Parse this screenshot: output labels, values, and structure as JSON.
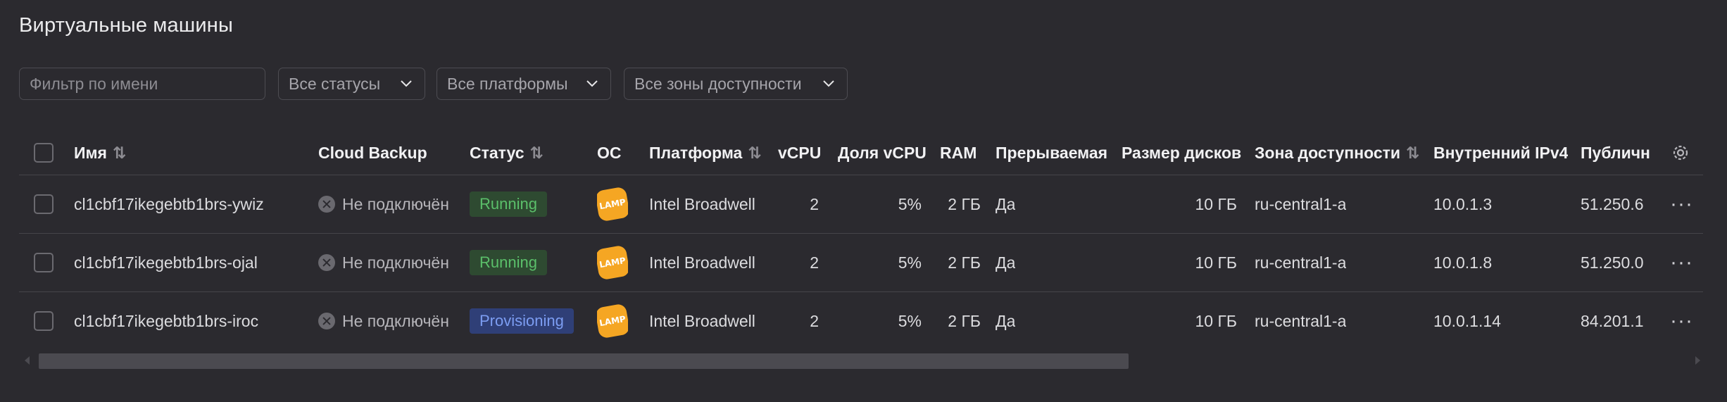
{
  "page": {
    "title": "Виртуальные машины"
  },
  "filters": {
    "name_placeholder": "Фильтр по имени",
    "status": "Все статусы",
    "platform": "Все платформы",
    "zone": "Все зоны доступности"
  },
  "table": {
    "columns": {
      "name": "Имя",
      "backup": "Cloud Backup",
      "status": "Статус",
      "os": "ОС",
      "platform": "Платформа",
      "vcpu": "vCPU",
      "vcpu_share": "Доля vCPU",
      "ram": "RAM",
      "preemptible": "Прерываемая",
      "disk_size": "Размер дисков",
      "zone": "Зона доступности",
      "ipv4_internal": "Внутренний IPv4",
      "ipv4_public": "Публичн"
    },
    "rows": [
      {
        "name": "cl1cbf17ikegebtb1brs-ywiz",
        "backup": "Не подключён",
        "status": "Running",
        "os": "LAMP",
        "platform": "Intel Broadwell",
        "vcpu": "2",
        "vcpu_share": "5%",
        "ram": "2 ГБ",
        "preemptible": "Да",
        "disk_size": "10 ГБ",
        "zone": "ru-central1-a",
        "ipv4_internal": "10.0.1.3",
        "ipv4_public": "51.250.6"
      },
      {
        "name": "cl1cbf17ikegebtb1brs-ojal",
        "backup": "Не подключён",
        "status": "Running",
        "os": "LAMP",
        "platform": "Intel Broadwell",
        "vcpu": "2",
        "vcpu_share": "5%",
        "ram": "2 ГБ",
        "preemptible": "Да",
        "disk_size": "10 ГБ",
        "zone": "ru-central1-a",
        "ipv4_internal": "10.0.1.8",
        "ipv4_public": "51.250.0"
      },
      {
        "name": "cl1cbf17ikegebtb1brs-iroc",
        "backup": "Не подключён",
        "status": "Provisioning",
        "os": "LAMP",
        "platform": "Intel Broadwell",
        "vcpu": "2",
        "vcpu_share": "5%",
        "ram": "2 ГБ",
        "preemptible": "Да",
        "disk_size": "10 ГБ",
        "zone": "ru-central1-a",
        "ipv4_internal": "10.0.1.14",
        "ipv4_public": "84.201.1"
      }
    ],
    "row_menu": "···"
  },
  "icons": {
    "sort": "sort-icon",
    "settings": "gear-icon",
    "backup_disconnected": "x-circle-icon",
    "more": "more-icon",
    "dropdown": "chevron-down-icon"
  },
  "colors": {
    "background": "#2b2a2f",
    "running_bg": "#2e4a31",
    "running_text": "#5bbf6a",
    "provisioning_bg": "#2f3f77",
    "provisioning_text": "#7c9df2",
    "lamp_badge": "#f5a623"
  },
  "scrollbar": {
    "position": 0.0,
    "visible_fraction": 0.65
  }
}
